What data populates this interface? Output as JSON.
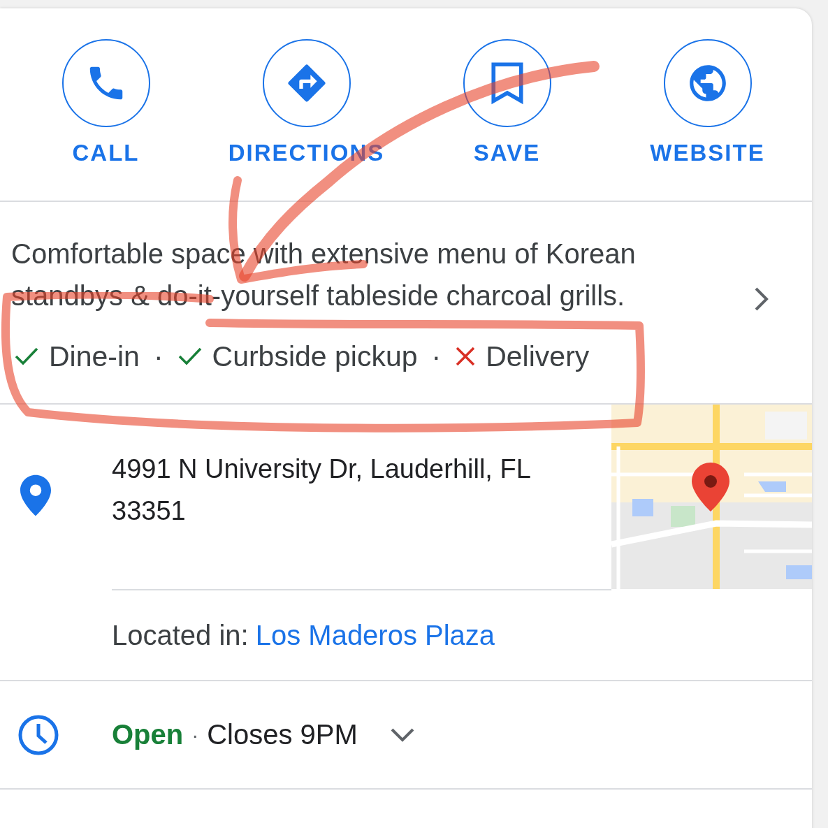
{
  "actions": [
    {
      "kind": "call",
      "label": "CALL"
    },
    {
      "kind": "directions",
      "label": "DIRECTIONS"
    },
    {
      "kind": "save",
      "label": "SAVE"
    },
    {
      "kind": "website",
      "label": "WEBSITE"
    }
  ],
  "description": "Comfortable space with extensive menu of Korean standbys & do-it-yourself tableside charcoal grills.",
  "separator": "·",
  "amenities": [
    {
      "label": "Dine-in",
      "available": true
    },
    {
      "label": "Curbside pickup",
      "available": true
    },
    {
      "label": "Delivery",
      "available": false
    }
  ],
  "address": "4991 N University Dr, Lauderhill, FL 33351",
  "located_in": {
    "label": "Located in:",
    "place": "Los Maderos Plaza"
  },
  "hours": {
    "open": true,
    "status": "Open",
    "closes": "Closes 9PM"
  }
}
